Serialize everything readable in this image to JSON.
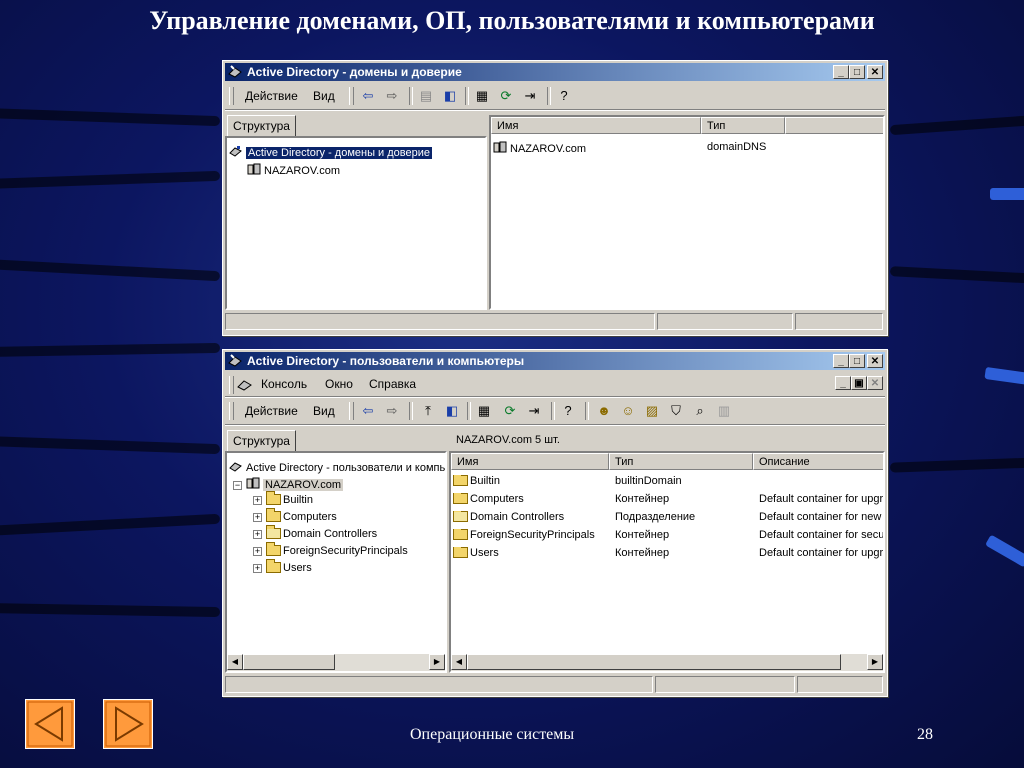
{
  "slide": {
    "title": "Управление доменами, ОП, пользователями и компьютерами",
    "footer": "Операционные системы",
    "page_number": "28"
  },
  "window1": {
    "title": "Active Directory - домены и доверие",
    "menu": {
      "action": "Действие",
      "view": "Вид"
    },
    "tree_tab": "Структура",
    "tree": {
      "root": "Active Directory - домены и доверие",
      "child": "NAZAROV.com"
    },
    "columns": [
      "Имя",
      "Тип"
    ],
    "rows": [
      {
        "name": "NAZAROV.com",
        "type": "domainDNS"
      }
    ]
  },
  "window2": {
    "title": "Active Directory - пользователи и компьютеры",
    "menu": {
      "console": "Консоль",
      "window": "Окно",
      "help": "Справка",
      "action": "Действие",
      "view": "Вид"
    },
    "tree_tab": "Структура",
    "list_header": "NAZAROV.com    5 шт.",
    "tree": {
      "root": "Active Directory - пользователи и компьютеры",
      "domain": "NAZAROV.com",
      "children": [
        "Builtin",
        "Computers",
        "Domain Controllers",
        "ForeignSecurityPrincipals",
        "Users"
      ]
    },
    "columns": [
      "Имя",
      "Тип",
      "Описание"
    ],
    "rows": [
      {
        "name": "Builtin",
        "type": "builtinDomain",
        "desc": ""
      },
      {
        "name": "Computers",
        "type": "Контейнер",
        "desc": "Default container for upgraded computer accounts"
      },
      {
        "name": "Domain Controllers",
        "type": "Подразделение",
        "desc": "Default container for new domain controllers"
      },
      {
        "name": "ForeignSecurityPrincipals",
        "type": "Контейнер",
        "desc": "Default container for security identifiers"
      },
      {
        "name": "Users",
        "type": "Контейнер",
        "desc": "Default container for upgraded user accounts"
      }
    ]
  }
}
